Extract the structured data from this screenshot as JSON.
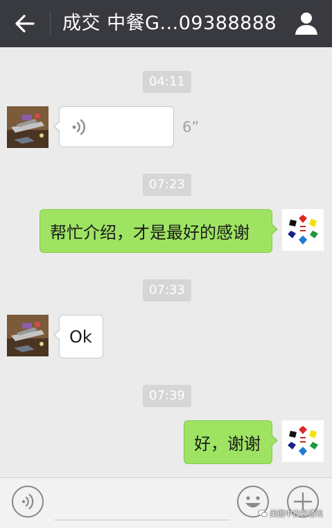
{
  "header": {
    "title": "成交   中餐G...09388888",
    "back_icon": "arrow-left-icon",
    "profile_icon": "person-icon"
  },
  "messages": [
    {
      "time": "04:11",
      "side": "left",
      "type": "voice",
      "duration": "6”",
      "icon": "voice-wave-icon"
    },
    {
      "time": "07:23",
      "side": "right",
      "type": "text",
      "text": "帮忙介绍，才是最好的感谢"
    },
    {
      "time": "07:33",
      "side": "left",
      "type": "text",
      "text": "Ok"
    },
    {
      "time": "07:39",
      "side": "right",
      "type": "text",
      "text": "好，谢谢"
    }
  ],
  "input_bar": {
    "voice_icon": "voice-wave-icon",
    "input_value": "",
    "emoji_icon": "smiley-icon",
    "more_icon": "plus-icon"
  },
  "watermark": {
    "text": "美国中日餐通讯"
  },
  "colors": {
    "header_bg": "#393a3f",
    "chat_bg": "#ebebeb",
    "sent_bubble": "#9ee462",
    "received_bubble": "#ffffff",
    "time_badge": "#d6d6d6"
  }
}
